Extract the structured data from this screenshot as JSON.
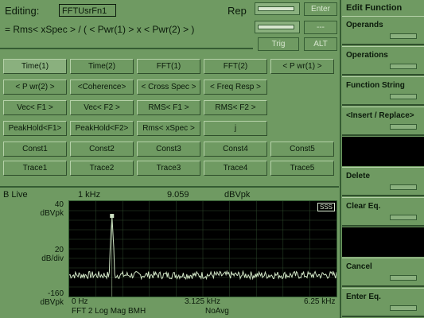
{
  "editor": {
    "editing_label": "Editing:",
    "function_name": "FFTUsrFn1",
    "mode": "Rep",
    "expression": "= Rms< xSpec > / ( < Pwr(1) > x < Pwr(2) > )"
  },
  "top_keys": {
    "enter": "Enter",
    "dashes": "---",
    "trig": "Trig",
    "alt": "ALT"
  },
  "softkeys": {
    "title": "Edit Function",
    "items": [
      {
        "label": "Operands"
      },
      {
        "label": "Operations"
      },
      {
        "label": "Function String"
      },
      {
        "label": "<Insert / Replace>"
      },
      {
        "label": ""
      },
      {
        "label": "Delete"
      },
      {
        "label": "Clear Eq."
      },
      {
        "label": ""
      },
      {
        "label": "Cancel"
      },
      {
        "label": "Enter Eq."
      }
    ]
  },
  "function_keys": [
    [
      "Time(1)",
      "Time(2)",
      "FFT(1)",
      "FFT(2)",
      "< P wr(1) >"
    ],
    [
      "< P wr(2) >",
      "<Coherence>",
      "< Cross Spec >",
      "< Freq Resp >",
      ""
    ],
    [
      "Vec< F1 >",
      "Vec< F2 >",
      "RMS< F1 >",
      "RMS< F2 >",
      ""
    ],
    [
      "PeakHold<F1>",
      "PeakHold<F2>",
      "Rms< xSpec >",
      "j",
      ""
    ],
    [
      "Const1",
      "Const2",
      "Const3",
      "Const4",
      "Const5"
    ],
    [
      "Trace1",
      "Trace2",
      "Trace3",
      "Trace4",
      "Trace5"
    ]
  ],
  "plot": {
    "live_label": "B Live",
    "marker_freq": "1 kHz",
    "marker_value": "9.059",
    "marker_unit": "dBVpk",
    "y_top": "40",
    "y_top_unit": "dBVpk",
    "y_mid": "20",
    "y_mid_unit": "dB/div",
    "y_bottom": "-160",
    "y_bottom_unit": "dBVpk",
    "x_start": "0 Hz",
    "x_mid": "3.125 kHz",
    "x_end": "6.25 kHz",
    "footer_left": "FFT 2 Log Mag BMH",
    "footer_mid": "NoAvg",
    "badge": "SSS"
  },
  "chart_data": {
    "type": "line",
    "xlim": [
      0,
      6.25
    ],
    "ylim": [
      -160,
      40
    ],
    "xlabel": "",
    "ylabel": "",
    "peak": {
      "x": 1.0,
      "y": 9.059
    },
    "noise_floor": -115
  }
}
